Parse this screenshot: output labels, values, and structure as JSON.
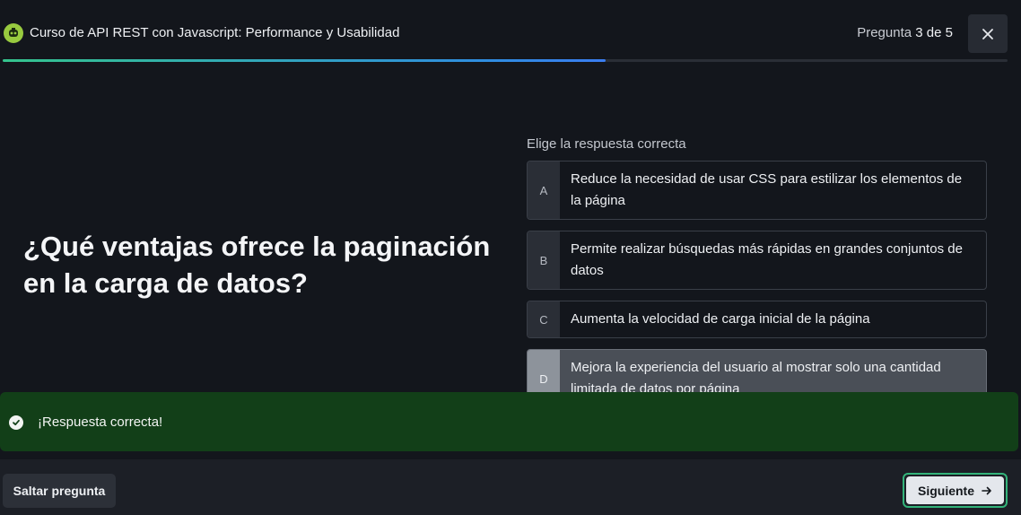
{
  "header": {
    "course_title": "Curso de API REST con Javascript: Performance y Usabilidad",
    "counter_prefix": "Pregunta",
    "counter_current": "3",
    "counter_sep": "de",
    "counter_total": "5",
    "progress_fraction": 0.6
  },
  "question": {
    "text": "¿Qué ventajas ofrece la paginación en la carga de datos?"
  },
  "answers": {
    "instruction": "Elige la respuesta correcta",
    "options": [
      {
        "letter": "A",
        "text": "Reduce la necesidad de usar CSS para estilizar los elementos de la página"
      },
      {
        "letter": "B",
        "text": "Permite realizar búsquedas más rápidas en grandes conjuntos de datos"
      },
      {
        "letter": "C",
        "text": "Aumenta la velocidad de carga inicial de la página"
      },
      {
        "letter": "D",
        "text": "Mejora la experiencia del usuario al mostrar solo una cantidad limitada de datos por página"
      }
    ],
    "selected": "D"
  },
  "feedback": {
    "text": "¡Respuesta correcta!"
  },
  "footer": {
    "skip_label": "Saltar pregunta",
    "next_label": "Siguiente"
  },
  "colors": {
    "background": "#13161c",
    "feedback_bg": "#123f18",
    "accent_green": "#33b37a",
    "progress_start": "#35c48d",
    "progress_end": "#3a7df0"
  }
}
